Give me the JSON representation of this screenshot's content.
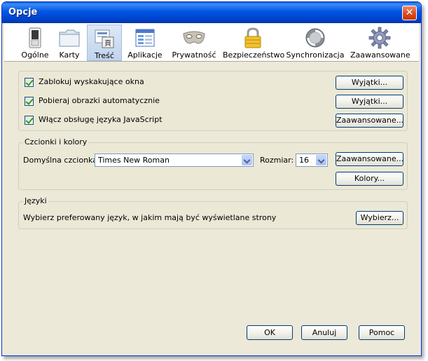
{
  "window": {
    "title": "Opcje",
    "close_symbol": "✕"
  },
  "toolbar": {
    "items": [
      {
        "label": "Ogólne",
        "icon": "switch-icon"
      },
      {
        "label": "Karty",
        "icon": "folder-tabs-icon"
      },
      {
        "label": "Treść",
        "icon": "content-page-icon",
        "selected": true
      },
      {
        "label": "Aplikacje",
        "icon": "applications-window-icon"
      },
      {
        "label": "Prywatność",
        "icon": "mask-icon"
      },
      {
        "label": "Bezpieczeństwo",
        "icon": "padlock-icon"
      },
      {
        "label": "Synchronizacja",
        "icon": "sync-icon"
      },
      {
        "label": "Zaawansowane",
        "icon": "gear-icon"
      }
    ]
  },
  "content": {
    "checkboxes": [
      {
        "label": "Zablokuj wyskakujące okna",
        "checked": true,
        "button": "Wyjątki..."
      },
      {
        "label": "Pobieraj obrazki automatycznie",
        "checked": true,
        "button": "Wyjątki..."
      },
      {
        "label": "Włącz obsługę języka JavaScript",
        "checked": true,
        "button": "Zaawansowane..."
      }
    ]
  },
  "fonts": {
    "legend": "Czcionki i kolory",
    "default_font_label": "Domyślna czcionka:",
    "default_font_value": "Times New Roman",
    "size_label": "Rozmiar:",
    "size_value": "16",
    "advanced_button": "Zaawansowane...",
    "colors_button": "Kolory..."
  },
  "languages": {
    "legend": "Języki",
    "description": "Wybierz preferowany język, w jakim mają być wyświetlane strony",
    "choose_button": "Wybierz..."
  },
  "footer": {
    "ok": "OK",
    "cancel": "Anuluj",
    "help": "Pomoc"
  }
}
